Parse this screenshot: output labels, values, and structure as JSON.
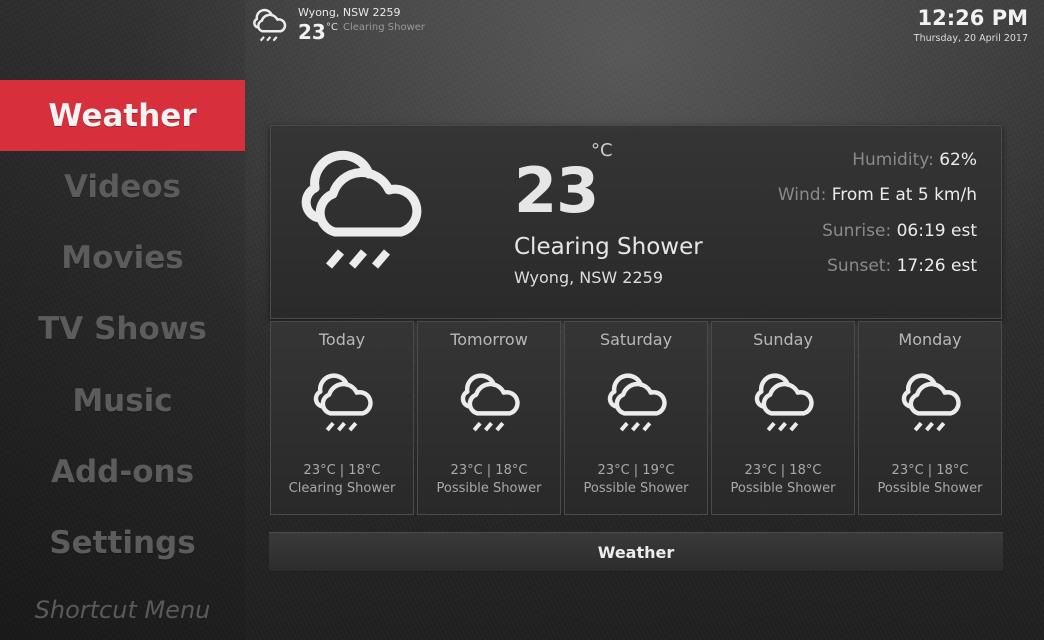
{
  "header": {
    "location": "Wyong, NSW 2259",
    "temp": "23",
    "unit": "°C",
    "condition": "Clearing Shower",
    "time": "12:26 PM",
    "date": "Thursday, 20 April 2017",
    "icon": "cloud-rain-icon"
  },
  "sidebar": {
    "items": [
      {
        "label": "Weather",
        "active": true
      },
      {
        "label": "Videos"
      },
      {
        "label": "Movies"
      },
      {
        "label": "TV Shows"
      },
      {
        "label": "Music"
      },
      {
        "label": "Add-ons"
      },
      {
        "label": "Settings"
      }
    ],
    "shortcut": "Shortcut Menu"
  },
  "current": {
    "temp": "23",
    "unit": "°C",
    "condition": "Clearing Shower",
    "location": "Wyong, NSW 2259",
    "icon": "cloud-rain-icon",
    "details": [
      {
        "label": "Humidity:",
        "value": "62%"
      },
      {
        "label": "Wind:",
        "value": "From E at 5 km/h"
      },
      {
        "label": "Sunrise:",
        "value": "06:19 est"
      },
      {
        "label": "Sunset:",
        "value": "17:26 est"
      }
    ]
  },
  "forecast": [
    {
      "day": "Today",
      "temps": "23°C | 18°C",
      "condition": "Clearing Shower",
      "icon": "cloud-rain-icon"
    },
    {
      "day": "Tomorrow",
      "temps": "23°C | 18°C",
      "condition": "Possible Shower",
      "icon": "cloud-rain-icon"
    },
    {
      "day": "Saturday",
      "temps": "23°C | 19°C",
      "condition": "Possible Shower",
      "icon": "cloud-rain-icon"
    },
    {
      "day": "Sunday",
      "temps": "23°C | 18°C",
      "condition": "Possible Shower",
      "icon": "cloud-rain-icon"
    },
    {
      "day": "Monday",
      "temps": "23°C | 18°C",
      "condition": "Possible Shower",
      "icon": "cloud-rain-icon"
    }
  ],
  "footer": {
    "label": "Weather"
  },
  "colors": {
    "accent": "#d72f3c",
    "background": "#2b2b2b",
    "panel": "#333333"
  }
}
